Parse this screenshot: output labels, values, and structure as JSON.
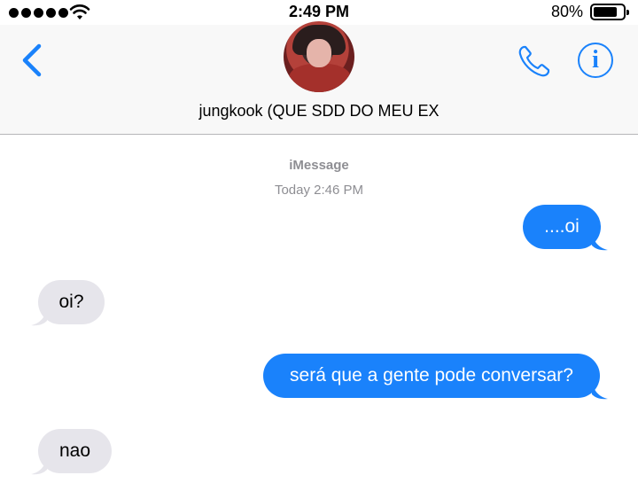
{
  "status_bar": {
    "time": "2:49 PM",
    "battery_percent": "80%",
    "battery_level": 0.8,
    "signal_icon": "signal-dots-icon",
    "wifi_icon": "wifi-icon"
  },
  "header": {
    "contact_name": "jungkook (QUE SDD DO MEU EX",
    "back_icon": "chevron-left-icon",
    "call_icon": "phone-icon",
    "info_icon": "info-icon",
    "info_glyph": "i"
  },
  "conversation": {
    "service": "iMessage",
    "timestamp": "Today 2:46 PM",
    "messages": [
      {
        "direction": "outgoing",
        "text": "....oi"
      },
      {
        "direction": "incoming",
        "text": "oi?"
      },
      {
        "direction": "outgoing",
        "text": "será que a gente pode conversar?"
      },
      {
        "direction": "incoming",
        "text": "nao"
      }
    ]
  },
  "colors": {
    "accent": "#1a82fb",
    "incoming_bubble": "#e6e5eb",
    "header_bg": "#f8f8f8",
    "meta_text": "#8e8e93"
  }
}
